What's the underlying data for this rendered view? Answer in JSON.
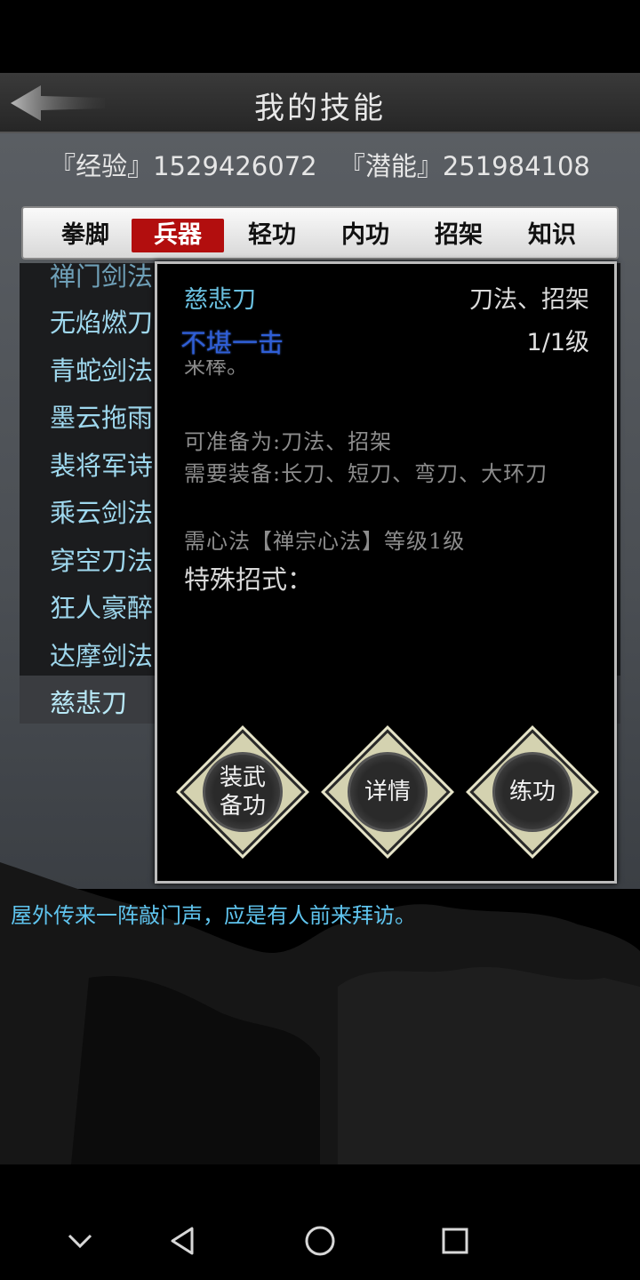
{
  "header": {
    "title": "我的技能"
  },
  "stats": {
    "exp": "『经验』1529426072",
    "potential": "『潜能』251984108"
  },
  "tabs": [
    {
      "label": "拳脚",
      "active": false
    },
    {
      "label": "兵器",
      "active": true
    },
    {
      "label": "轻功",
      "active": false
    },
    {
      "label": "内功",
      "active": false
    },
    {
      "label": "招架",
      "active": false
    },
    {
      "label": "知识",
      "active": false
    }
  ],
  "skills": [
    {
      "name": "禅门剑法"
    },
    {
      "name": "无焰燃刀"
    },
    {
      "name": "青蛇剑法"
    },
    {
      "name": "墨云拖雨"
    },
    {
      "name": "裴将军诗"
    },
    {
      "name": "乘云剑法"
    },
    {
      "name": "穿空刀法"
    },
    {
      "name": "狂人豪醉"
    },
    {
      "name": "达摩剑法"
    },
    {
      "name": "慈悲刀",
      "selected": true
    }
  ],
  "popup": {
    "name": "慈悲刀",
    "types": "刀法、招架",
    "rank": "不堪一击",
    "level": "1/1级",
    "desc_fragment": "来棒。",
    "can_prepare": "可准备为:刀法、招架",
    "needs_equip": "需要装备:长刀、短刀、弯刀、大环刀",
    "needs_method": "需心法【禅宗心法】等级1级",
    "special_moves": "特殊招式：",
    "buttons": {
      "equip_line1": "装武",
      "equip_line2": "备功",
      "details": "详情",
      "practice": "练功"
    }
  },
  "message": "屋外传来一阵敲门声，应是有人前来拜访。",
  "colors": {
    "active_tab": "#b20e0e",
    "skill_name": "#9fd8ee",
    "rank_text": "#2f5fd8",
    "message": "#5fc4ee"
  },
  "icons": {
    "back": "back-arrow-icon",
    "nav": [
      "chevron-down-icon",
      "back-triangle-icon",
      "home-circle-icon",
      "recents-square-icon"
    ]
  }
}
